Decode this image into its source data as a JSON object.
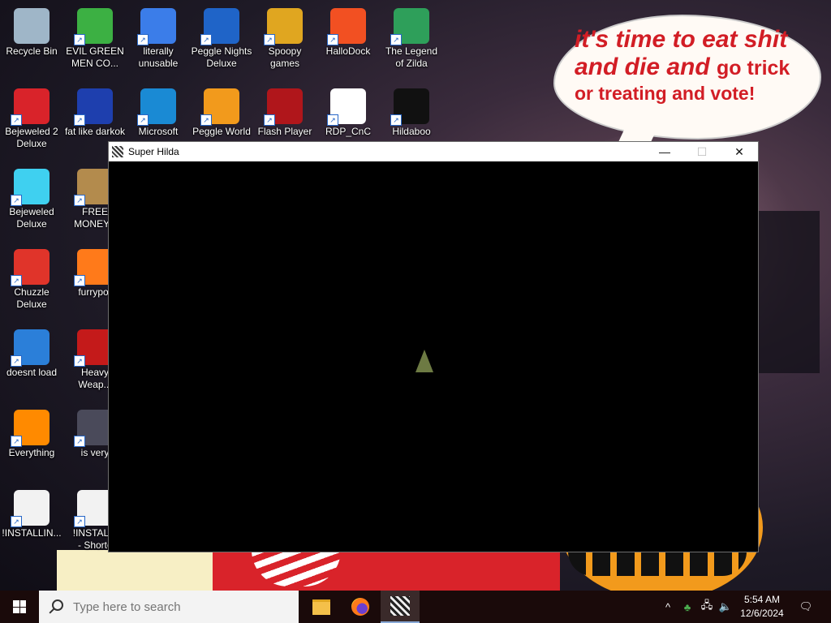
{
  "desktop": {
    "speech_bubble": {
      "line1": "it's time to eat shit",
      "line2a": "and die and ",
      "line2b": "go trick",
      "line3": "or treating and vote!"
    },
    "icons": [
      {
        "label": "Recycle Bin",
        "icon": "recycle-bin-icon",
        "color": "#9fb6c8"
      },
      {
        "label": "EVIL GREEN\nMEN CO...",
        "icon": "green-men-icon",
        "color": "#3cb043"
      },
      {
        "label": "literally\nunusable",
        "icon": "chrome-icon",
        "color": "#3b7de9"
      },
      {
        "label": "Peggle Nights\nDeluxe",
        "icon": "peggle-nights-icon",
        "color": "#1f64c8"
      },
      {
        "label": "Spoopy\ngames",
        "icon": "folder-games-icon",
        "color": "#e0a620"
      },
      {
        "label": "HalloDock",
        "icon": "windows-logo-icon",
        "color": "#f25022"
      },
      {
        "label": "The Legend\nof Zilda",
        "icon": "zelda-icon",
        "color": "#2e9f5a"
      },
      {
        "label": "Bejeweled 2\nDeluxe",
        "icon": "bejeweled2-icon",
        "color": "#d9232a"
      },
      {
        "label": "fat like darkok",
        "icon": "mpl-icon",
        "color": "#1e3fae"
      },
      {
        "label": "Microsoft",
        "icon": "edge-icon",
        "color": "#1a8ad4"
      },
      {
        "label": "Peggle World",
        "icon": "peggle-world-icon",
        "color": "#f29a1c"
      },
      {
        "label": "Flash Player",
        "icon": "flash-icon",
        "color": "#b0161b"
      },
      {
        "label": "RDP_CnC",
        "icon": "rdp-icon",
        "color": "#ffffff"
      },
      {
        "label": "Hildaboo",
        "icon": "hildaboo-icon",
        "color": "#111111"
      },
      {
        "label": "Bejeweled\nDeluxe",
        "icon": "bejeweled-icon",
        "color": "#3fd0f0"
      },
      {
        "label": "FREE\nMONEY.c",
        "icon": "money-bag-icon",
        "color": "#b38b4d"
      },
      {
        "label": "Chuzzle\nDeluxe",
        "icon": "chuzzle-icon",
        "color": "#e0342a"
      },
      {
        "label": "furrypor",
        "icon": "firefox-icon",
        "color": "#ff7a1a"
      },
      {
        "label": "doesnt load",
        "icon": "thunderbird-icon",
        "color": "#2b7fd9"
      },
      {
        "label": "Heavy\nWeap...",
        "icon": "radiation-icon",
        "color": "#c41a1a"
      },
      {
        "label": "Everything",
        "icon": "everything-search-icon",
        "color": "#ff8a00"
      },
      {
        "label": "is very",
        "icon": "mpl-shield-icon",
        "color": "#4a4a5a"
      },
      {
        "label": "!INSTALLIN...",
        "icon": "text-file-icon",
        "color": "#f2f2f2"
      },
      {
        "label": "!INSTALLI\n- Shortc",
        "icon": "text-file-shortcut-icon",
        "color": "#f2f2f2"
      }
    ]
  },
  "window": {
    "title": "Super Hilda",
    "minimize_glyph": "—",
    "maximize_glyph": "☐",
    "close_glyph": "✕"
  },
  "taskbar": {
    "search_placeholder": "Type here to search",
    "apps": [
      {
        "name": "File Explorer",
        "icon": "folder-icon"
      },
      {
        "name": "Firefox",
        "icon": "firefox-icon"
      },
      {
        "name": "Super Hilda",
        "icon": "super-hilda-icon",
        "active": true
      }
    ],
    "tray": {
      "chevron": "^",
      "time": "5:54 AM",
      "date": "12/6/2024"
    }
  }
}
